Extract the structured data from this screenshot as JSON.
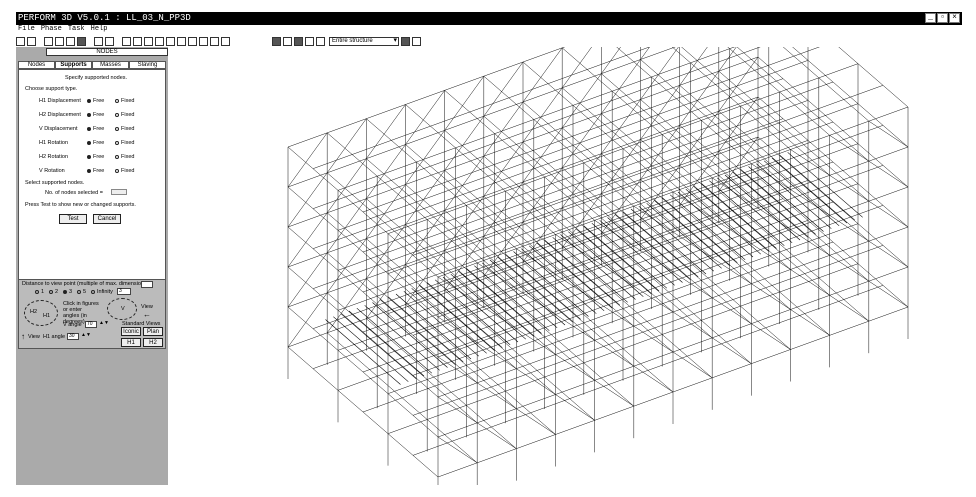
{
  "window": {
    "title": "PERFORM 3D V5.0.1 : LL_03_N_PP3D"
  },
  "menu": [
    "File",
    "Phase",
    "Task",
    "Help"
  ],
  "toolbar": {
    "structure_select": "Entire structure"
  },
  "panel": {
    "nodes_header": "NODES",
    "tabs": [
      "Nodes",
      "Supports",
      "Masses",
      "Slaving"
    ],
    "specify_text": "Specify supported nodes.",
    "choose_text": "Choose support type.",
    "rows": [
      {
        "label": "H1 Displacement",
        "free": "Free",
        "fixed": "Fixed"
      },
      {
        "label": "H2 Displacement",
        "free": "Free",
        "fixed": "Fixed"
      },
      {
        "label": "V Displacement",
        "free": "Free",
        "fixed": "Fixed"
      },
      {
        "label": "H1 Rotation",
        "free": "Free",
        "fixed": "Fixed"
      },
      {
        "label": "H2 Rotation",
        "free": "Free",
        "fixed": "Fixed"
      },
      {
        "label": "V Rotation",
        "free": "Free",
        "fixed": "Fixed"
      }
    ],
    "select_text": "Select supported nodes.",
    "count_label": "No. of nodes selected =",
    "press_text": "Press Test to show new or changed supports.",
    "test_button": "Test",
    "cancel_button": "Cancel"
  },
  "view": {
    "distance_label": "Distance to view point (multiple of max. dimension)",
    "distance_options": [
      "1",
      "2",
      "3",
      "5",
      "Infinity"
    ],
    "distance_value": "3",
    "dial_left": "H2",
    "dial_left_sub": "H1",
    "dial_right": "V",
    "click_text": "Click in figures or enter angles (in degrees)",
    "view_left": "View",
    "view_right": "View",
    "v_angle_label": "V angle",
    "v_angle_value": "70",
    "h1_angle_label": "H1 angle",
    "h1_angle_value": "30",
    "standard_views_label": "Standard Views",
    "std_buttons": [
      "Iconic",
      "Plan",
      "H1",
      "H2"
    ]
  }
}
